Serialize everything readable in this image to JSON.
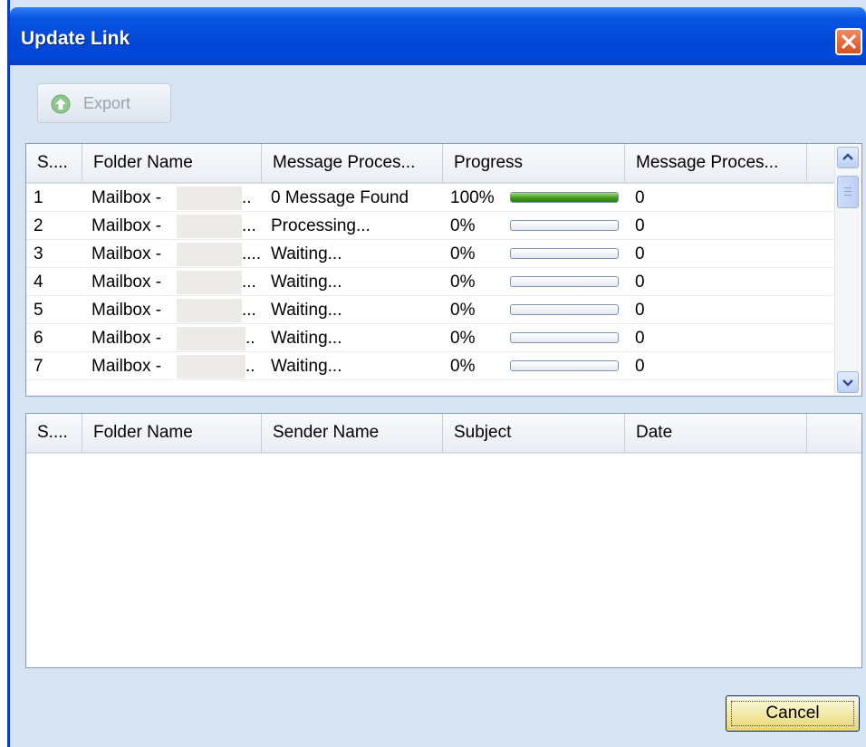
{
  "window": {
    "title": "Update Link"
  },
  "toolbar": {
    "export_label": "Export",
    "export_enabled": false
  },
  "upper_grid": {
    "columns": [
      "S....",
      "Folder Name",
      "Message Proces...",
      "Progress",
      "Message Proces..."
    ],
    "rows": [
      {
        "sn": "1",
        "folder": "Mailbox -",
        "folder_tail": "..",
        "status": "0 Message Found",
        "progress_text": "100%",
        "progress": 1.0,
        "count": "0"
      },
      {
        "sn": "2",
        "folder": "Mailbox -",
        "folder_tail": "...",
        "status": "Processing...",
        "progress_text": "0%",
        "progress": 0,
        "count": "0"
      },
      {
        "sn": "3",
        "folder": "Mailbox -",
        "folder_tail": "....",
        "status": "Waiting...",
        "progress_text": "0%",
        "progress": 0,
        "count": "0"
      },
      {
        "sn": "4",
        "folder": "Mailbox -",
        "folder_tail": "...",
        "status": "Waiting...",
        "progress_text": "0%",
        "progress": 0,
        "count": "0"
      },
      {
        "sn": "5",
        "folder": "Mailbox -",
        "folder_tail": "...",
        "status": "Waiting...",
        "progress_text": "0%",
        "progress": 0,
        "count": "0"
      },
      {
        "sn": "6",
        "folder": "Mailbox -",
        "folder_tail": "..",
        "status": "Waiting...",
        "progress_text": "0%",
        "progress": 0,
        "count": "0"
      },
      {
        "sn": "7",
        "folder": "Mailbox -",
        "folder_tail": "..",
        "status": "Waiting...",
        "progress_text": "0%",
        "progress": 0,
        "count": "0"
      }
    ]
  },
  "lower_grid": {
    "columns": [
      "S....",
      "Folder Name",
      "Sender Name",
      "Subject",
      "Date"
    ],
    "rows": []
  },
  "footer": {
    "cancel_label": "Cancel"
  },
  "colors": {
    "title_bar": "#0047d6",
    "window_bg": "#d6e3f2",
    "progress_fill": "#3f9a1a",
    "close_button": "#d8501f"
  }
}
